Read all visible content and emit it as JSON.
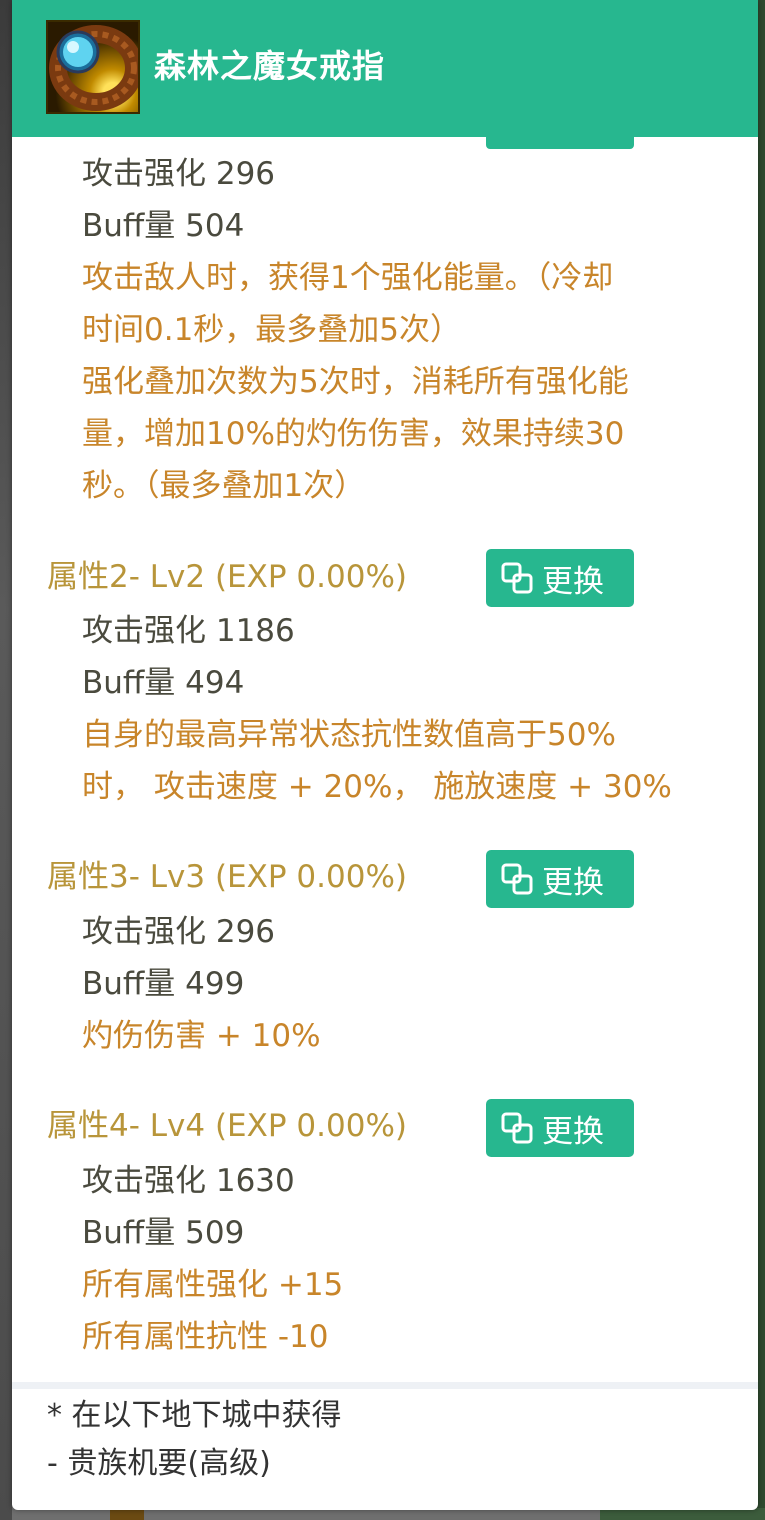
{
  "header": {
    "title": "森林之魔女戒指",
    "icon": "ring-icon"
  },
  "attr1": {
    "stats": [
      "攻击强化 296",
      "Buff量 504"
    ],
    "effects": [
      "攻击敌人时，获得1个强化能量。（冷却",
      "时间0.1秒，最多叠加5次）",
      "强化叠加次数为5次时，消耗所有强化能",
      "量，增加10%的灼伤伤害，效果持续30",
      "秒。（最多叠加1次）"
    ]
  },
  "attr2": {
    "title": "属性2- Lv2 (EXP 0.00%)",
    "button": "更换",
    "stats": [
      "攻击强化 1186",
      "Buff量 494"
    ],
    "effects": [
      "自身的最高异常状态抗性数值高于50%",
      "时， 攻击速度 + 20%， 施放速度 + 30%"
    ]
  },
  "attr3": {
    "title": "属性3- Lv3 (EXP 0.00%)",
    "button": "更换",
    "stats": [
      "攻击强化 296",
      "Buff量 499"
    ],
    "effects": [
      "灼伤伤害 + 10%"
    ]
  },
  "attr4": {
    "title": "属性4- Lv4 (EXP 0.00%)",
    "button": "更换",
    "stats": [
      "攻击强化 1630",
      "Buff量 509"
    ],
    "effects": [
      "所有属性强化 +15",
      "所有属性抗性 -10"
    ]
  },
  "footer": {
    "source_label": "* 在以下地下城中获得",
    "dungeon": "- 贵族机要(高级)"
  },
  "colors": {
    "header": "#27b78f",
    "stat_text": "#4a4a3e",
    "effect_text": "#c8852a",
    "attr_title": "#b8953a"
  }
}
